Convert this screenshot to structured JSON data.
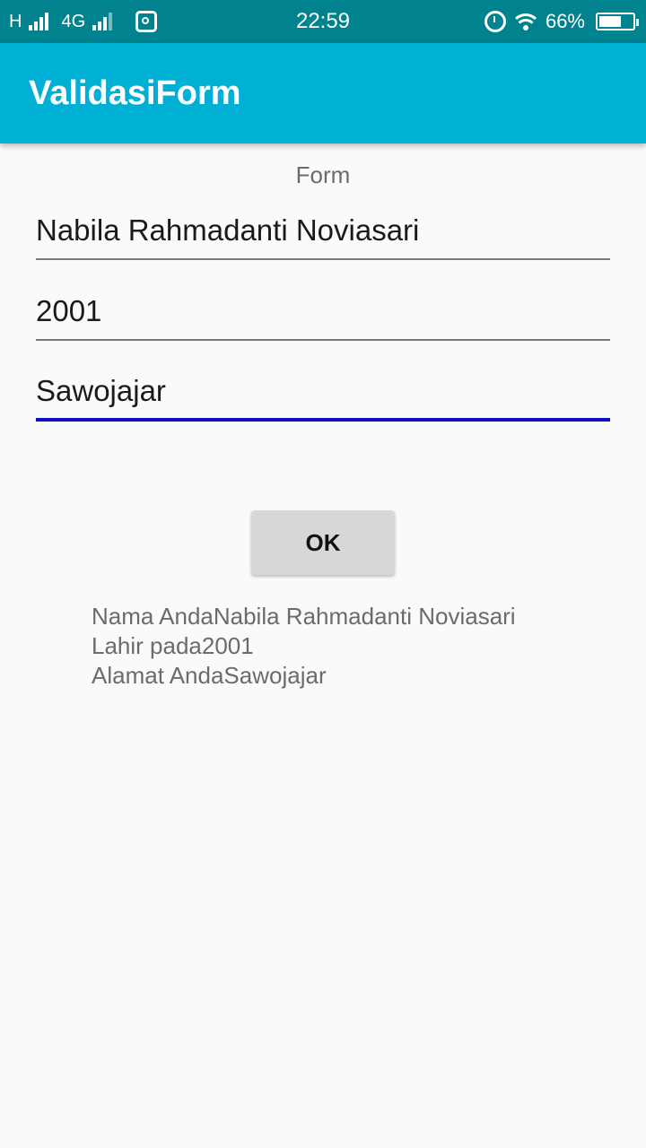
{
  "status_bar": {
    "network_h": "H",
    "network_4g": "4G",
    "time": "22:59",
    "battery_percent": "66%",
    "battery_level": 0.66
  },
  "app_bar": {
    "title": "ValidasiForm"
  },
  "form": {
    "label": "Form",
    "name_value": "Nabila Rahmadanti Noviasari",
    "year_value": "2001",
    "address_value": "Sawojajar",
    "focus_color": "#1010c0"
  },
  "ok_button": {
    "label": "OK"
  },
  "result": {
    "line1": "Nama AndaNabila Rahmadanti Noviasari",
    "line2": "Lahir pada2001",
    "line3": "Alamat AndaSawojajar"
  },
  "colors": {
    "status_bar": "#00838f",
    "app_bar": "#00b0d4",
    "background": "#fafafa"
  }
}
